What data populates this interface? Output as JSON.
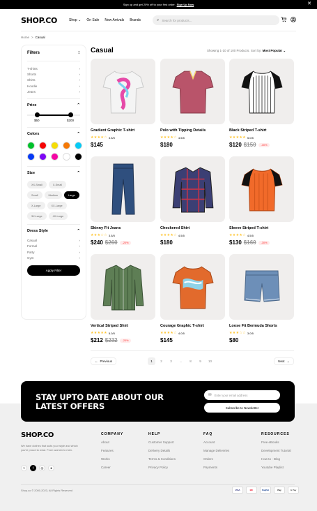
{
  "topbar": {
    "text": "Sign up and get 20% off to your first order.",
    "link": "Sign Up Now",
    "close": "✕"
  },
  "header": {
    "logo": "SHOP.CO",
    "nav": [
      "Shop",
      "On Sale",
      "New Arrivals",
      "Brands"
    ],
    "search_placeholder": "Search for products...",
    "icons": [
      "cart-icon",
      "user-icon"
    ]
  },
  "breadcrumb": {
    "home": "Home",
    "sep": ">",
    "current": "Casual"
  },
  "filters": {
    "title": "Filters",
    "categories": [
      "T-shirts",
      "Shorts",
      "Shirts",
      "Hoodie",
      "Jeans"
    ],
    "price": {
      "label": "Price",
      "min": "$50",
      "max": "$200"
    },
    "colors_label": "Colors",
    "colors": [
      "#00c12b",
      "#f50606",
      "#f5dd06",
      "#f57906",
      "#06caf5",
      "#063af5",
      "#7d06f5",
      "#f506a4",
      "#ffffff",
      "#000000"
    ],
    "size_label": "Size",
    "sizes": [
      "XX-Small",
      "X-Small",
      "Small",
      "Medium",
      "Large",
      "X-Large",
      "XX-Large",
      "3X-Large",
      "4X-Large"
    ],
    "active_size": "Large",
    "dress_label": "Dress Style",
    "dress_styles": [
      "Casual",
      "Formal",
      "Party",
      "Gym"
    ],
    "apply": "Apply Filter"
  },
  "main": {
    "title": "Casual",
    "showing": "Showing 1-10 of 100 Products",
    "sort_label": "Sort by:",
    "sort_value": "Most Popular"
  },
  "products": [
    {
      "name": "Gradient Graphic T-shirt",
      "stars": "★★★★☆",
      "rating": "3.5/5",
      "price": "$145",
      "old": "",
      "disc": ""
    },
    {
      "name": "Polo with Tipping Details",
      "stars": "★★★★☆",
      "rating": "4.5/5",
      "price": "$180",
      "old": "",
      "disc": ""
    },
    {
      "name": "Black Striped T-shirt",
      "stars": "★★★★★",
      "rating": "5.0/5",
      "price": "$120",
      "old": "$150",
      "disc": "-30%"
    },
    {
      "name": "Skinny Fit Jeans",
      "stars": "★★★☆☆",
      "rating": "3.5/5",
      "price": "$240",
      "old": "$260",
      "disc": "-20%"
    },
    {
      "name": "Checkered Shirt",
      "stars": "★★★★☆",
      "rating": "4.5/5",
      "price": "$180",
      "old": "",
      "disc": ""
    },
    {
      "name": "Sleeve Striped T-shirt",
      "stars": "★★★★☆",
      "rating": "4.5/5",
      "price": "$130",
      "old": "$160",
      "disc": "-30%"
    },
    {
      "name": "Vertical Striped Shirt",
      "stars": "★★★★★",
      "rating": "5.0/5",
      "price": "$212",
      "old": "$232",
      "disc": "-20%"
    },
    {
      "name": "Courage Graphic T-shirt",
      "stars": "★★★★☆",
      "rating": "4.0/5",
      "price": "$145",
      "old": "",
      "disc": ""
    },
    {
      "name": "Loose Fit Bermuda Shorts",
      "stars": "★★★☆☆",
      "rating": "3.0/5",
      "price": "$80",
      "old": "",
      "disc": ""
    }
  ],
  "pagination": {
    "prev": "Previous",
    "next": "Next",
    "pages": [
      "1",
      "2",
      "3",
      "...",
      "8",
      "9",
      "10"
    ],
    "active": "1"
  },
  "newsletter": {
    "heading": "STAY UPTO DATE ABOUT OUR LATEST OFFERS",
    "email_placeholder": "Enter your email address",
    "subscribe": "Subscribe to Newsletter"
  },
  "footer": {
    "logo": "SHOP.CO",
    "desc": "We have clothes that suits your style and which you're proud to wear. From women to men.",
    "columns": [
      {
        "title": "COMPANY",
        "links": [
          "About",
          "Features",
          "Works",
          "Career"
        ]
      },
      {
        "title": "HELP",
        "links": [
          "Customer Support",
          "Delivery Details",
          "Terms & Conditions",
          "Privacy Policy"
        ]
      },
      {
        "title": "FAQ",
        "links": [
          "Account",
          "Manage Deliveries",
          "Orders",
          "Payments"
        ]
      },
      {
        "title": "RESOURCES",
        "links": [
          "Free eBooks",
          "Development Tutorial",
          "How to - Blog",
          "Youtube Playlist"
        ]
      }
    ],
    "copyright": "Shop.co © 2000-2023, All Rights Reserved",
    "payments": [
      "VISA",
      "MC",
      "PayPal",
      "Pay",
      "G Pay"
    ]
  }
}
